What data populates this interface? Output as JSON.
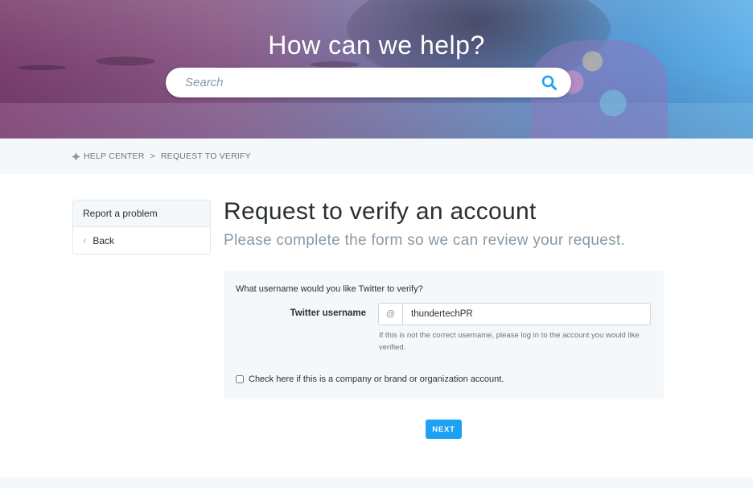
{
  "hero": {
    "title": "How can we help?",
    "search_placeholder": "Search",
    "search_icon": "search-icon"
  },
  "breadcrumb": {
    "icon": "gear-icon",
    "items": [
      "HELP CENTER",
      "REQUEST TO VERIFY"
    ],
    "separator": ">"
  },
  "sidebar": {
    "items": [
      {
        "label": "Report a problem"
      },
      {
        "label": "Back",
        "icon": "chevron-left-icon"
      }
    ]
  },
  "main": {
    "title": "Request to verify an account",
    "subtitle": "Please complete the form so we can review your request."
  },
  "form": {
    "question": "What username would you like Twitter to verify?",
    "username_label": "Twitter username",
    "at_prefix": "@",
    "username_value": "thundertechPR",
    "help_text": "If this is not the correct username, please log in to the account you would like verified.",
    "checkbox_label": "Check here if this is a company or brand or organization account.",
    "checkbox_checked": false
  },
  "actions": {
    "next_label": "NEXT"
  },
  "colors": {
    "accent": "#1da1f2",
    "panel_bg": "#f5f8fa",
    "muted_text": "#8899a6"
  }
}
